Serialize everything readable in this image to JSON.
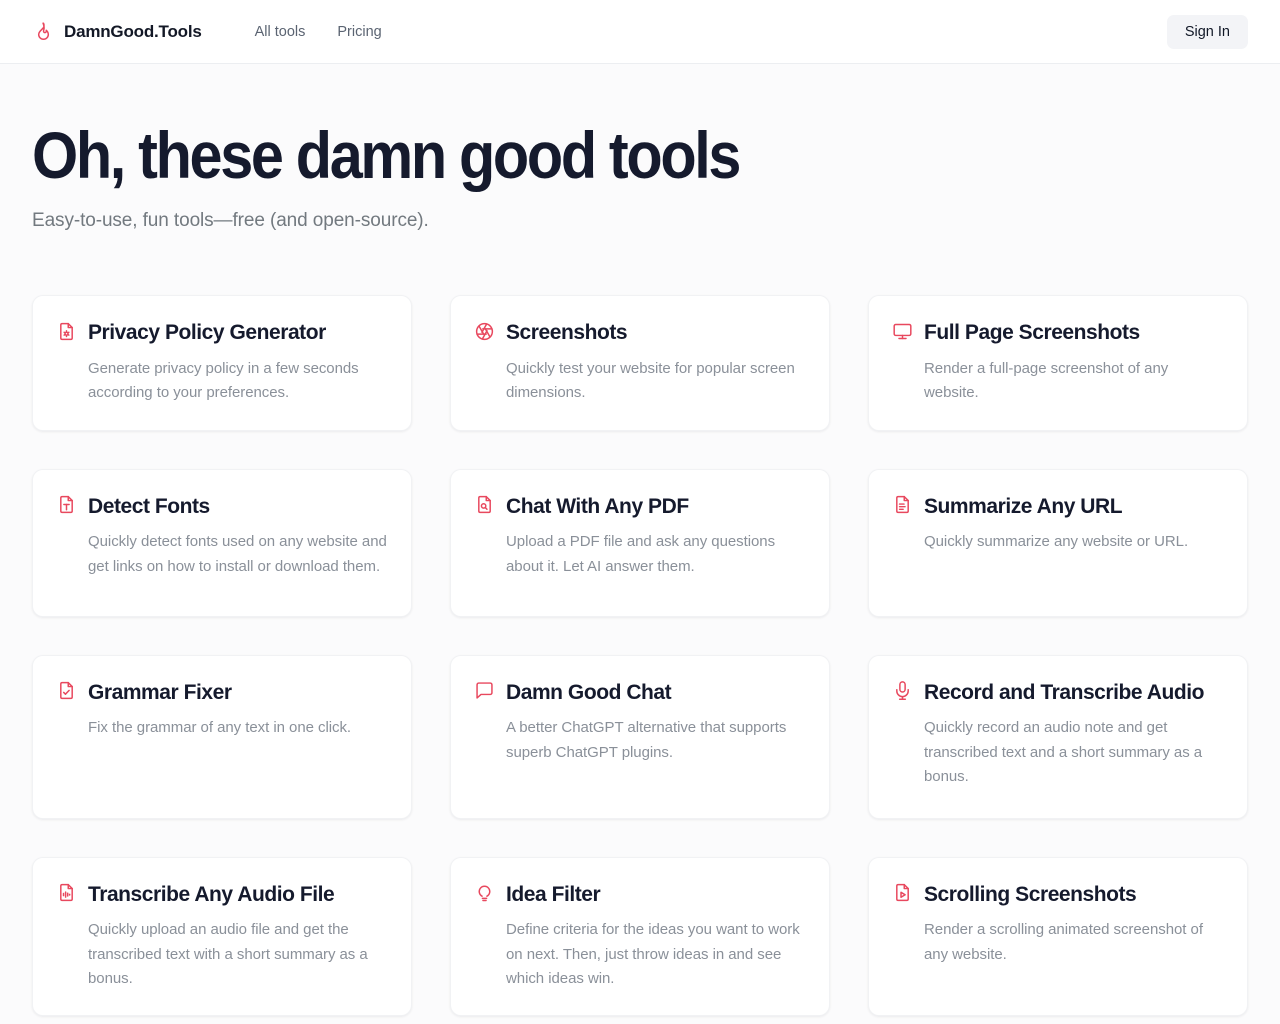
{
  "header": {
    "logo_icon": "flame-icon",
    "brand": "DamnGood.Tools",
    "nav": [
      {
        "label": "All tools"
      },
      {
        "label": "Pricing"
      }
    ],
    "signin_label": "Sign In"
  },
  "hero": {
    "title": "Oh, these damn good tools",
    "subtitle": "Easy-to-use, fun tools—free (and open-source)."
  },
  "colors": {
    "accent": "#e8485e",
    "ink": "#151a2d",
    "muted": "#8a9099",
    "page_bg": "#fbfbfc",
    "card_bg": "#ffffff"
  },
  "tools": [
    {
      "icon": "document-gear-icon",
      "title": "Privacy Policy Generator",
      "description": "Generate privacy policy in a few seconds according to your preferences."
    },
    {
      "icon": "aperture-icon",
      "title": "Screenshots",
      "description": "Quickly test your website for popular screen dimensions."
    },
    {
      "icon": "monitor-icon",
      "title": "Full Page Screenshots",
      "description": "Render a full-page screenshot of any website."
    },
    {
      "icon": "document-type-icon",
      "title": "Detect Fonts",
      "description": "Quickly detect fonts used on any website and get links on how to install or download them."
    },
    {
      "icon": "document-search-icon",
      "title": "Chat With Any PDF",
      "description": "Upload a PDF file and ask any questions about it. Let AI answer them."
    },
    {
      "icon": "document-lines-icon",
      "title": "Summarize Any URL",
      "description": "Quickly summarize any website or URL."
    },
    {
      "icon": "document-check-icon",
      "title": "Grammar Fixer",
      "description": "Fix the grammar of any text in one click."
    },
    {
      "icon": "chat-bubble-icon",
      "title": "Damn Good Chat",
      "description": "A better ChatGPT alternative that supports superb ChatGPT plugins."
    },
    {
      "icon": "microphone-icon",
      "title": "Record and Transcribe Audio",
      "description": "Quickly record an audio note and get transcribed text and a short summary as a bonus."
    },
    {
      "icon": "document-audio-icon",
      "title": "Transcribe Any Audio File",
      "description": "Quickly upload an audio file and get the transcribed text with a short summary as a bonus."
    },
    {
      "icon": "lightbulb-icon",
      "title": "Idea Filter",
      "description": "Define criteria for the ideas you want to work on next. Then, just throw ideas in and see which ideas win."
    },
    {
      "icon": "document-play-icon",
      "title": "Scrolling Screenshots",
      "description": "Render a scrolling animated screenshot of any website."
    }
  ]
}
